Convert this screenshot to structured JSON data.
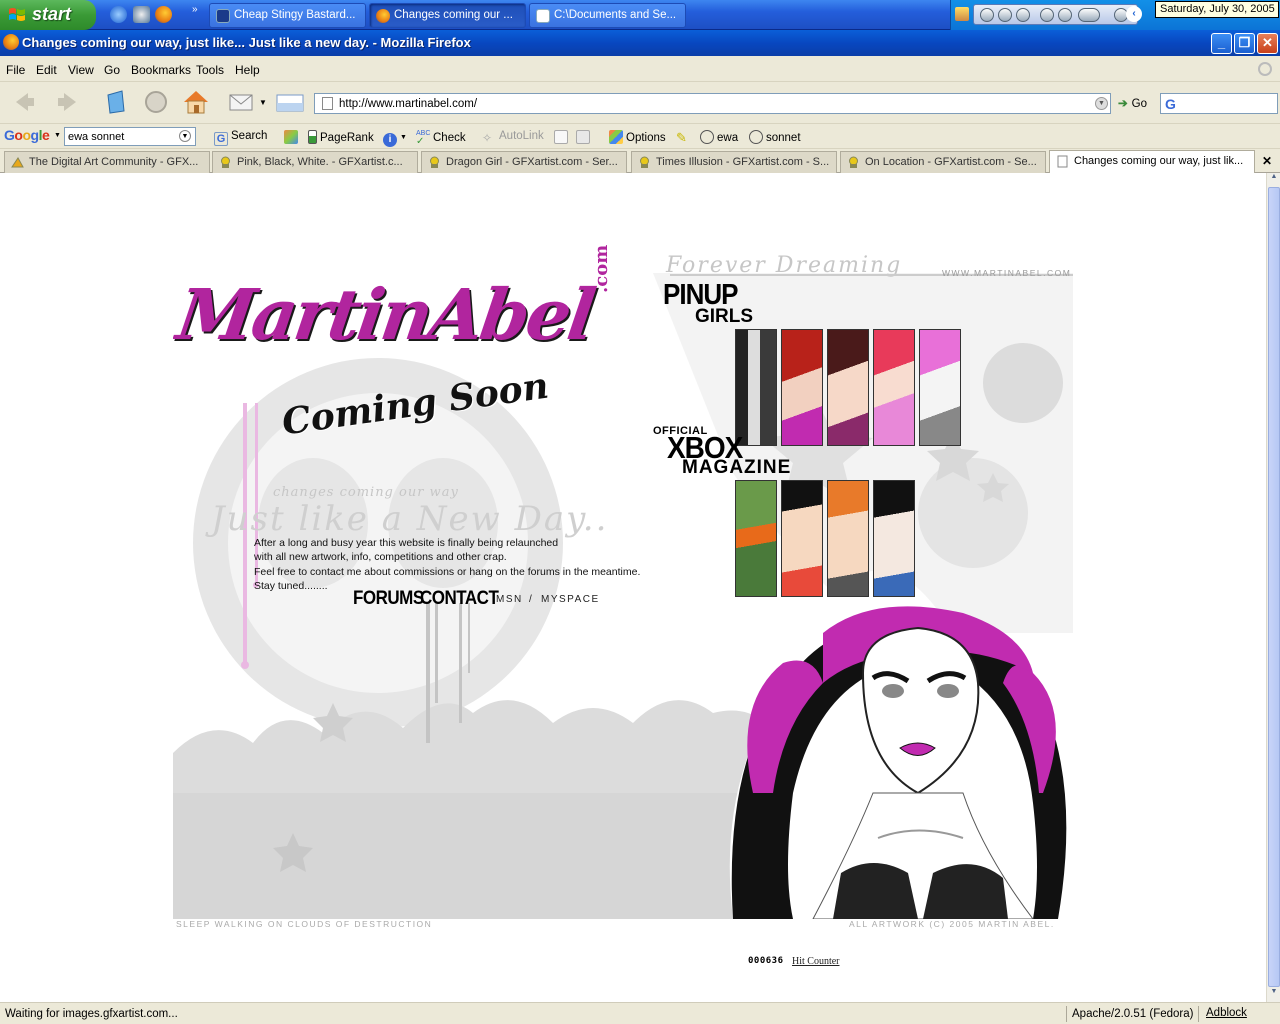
{
  "taskbar": {
    "start_label": "start",
    "tasks": [
      {
        "label": "Cheap Stingy Bastard..."
      },
      {
        "label": "Changes coming our ..."
      },
      {
        "label": "C:\\Documents and Se..."
      }
    ],
    "clock_tooltip": "Saturday, July 30, 2005"
  },
  "window": {
    "title": "Changes coming our way, just like... Just like a new day. - Mozilla Firefox"
  },
  "menu": {
    "items": [
      {
        "label": "File"
      },
      {
        "label": "Edit"
      },
      {
        "label": "View"
      },
      {
        "label": "Go"
      },
      {
        "label": "Bookmarks"
      },
      {
        "label": "Tools"
      },
      {
        "label": "Help"
      }
    ]
  },
  "navbar": {
    "url": "http://www.martinabel.com/",
    "go_label": "Go"
  },
  "google_toolbar": {
    "logo": "Google",
    "search_value": "ewa sonnet",
    "buttons": {
      "search": "Search",
      "pagerank": "PageRank",
      "check": "Check",
      "autolink": "AutoLink",
      "options": "Options",
      "highlight_1": "ewa",
      "highlight_2": "sonnet"
    }
  },
  "tabs": [
    {
      "label": "The Digital Art Community - GFX..."
    },
    {
      "label": "Pink, Black, White. - GFXartist.c..."
    },
    {
      "label": "Dragon Girl - GFXartist.com - Ser..."
    },
    {
      "label": "Times Illusion - GFXartist.com - S..."
    },
    {
      "label": "On Location - GFXartist.com - Se..."
    },
    {
      "label": "Changes coming our way, just lik..."
    }
  ],
  "site": {
    "logo_text": "MartinAbel",
    "logo_com": ".com",
    "coming_soon": "Coming Soon",
    "tagline_small": "changes coming our way",
    "tagline_big": "Just like a New Day..",
    "intro_lines": [
      "After a long and busy year this website is finally being relaunched",
      "with all new artwork, info, competitions and other crap.",
      "Feel free to contact me about commissions or hang on the forums in the meantime.",
      "Stay tuned........"
    ],
    "nav": {
      "forums": "FORUMS",
      "contact": "CONTACT",
      "msn": "MSN",
      "sep": "/",
      "myspace": "MYSPACE"
    },
    "forever": "Forever Dreaming",
    "url_text": "WWW.MARTINABEL.COM",
    "pinup": "PINUP",
    "girls": "GIRLS",
    "official": "OFFICIAL",
    "xbox": "XBOX",
    "magazine": "MAGAZINE",
    "footer_left": "SLEEP WALKING ON CLOUDS OF DESTRUCTION",
    "footer_right": "ALL ARTWORK (C) 2005 MARTIN ABEL.",
    "counter_value": "000636",
    "counter_link": "Hit Counter",
    "colors": {
      "accent": "#b1259e",
      "bg_gray": "#dcdcdc"
    }
  },
  "statusbar": {
    "text": "Waiting for images.gfxartist.com...",
    "server": "Apache/2.0.51 (Fedora)",
    "adblock": "Adblock"
  }
}
